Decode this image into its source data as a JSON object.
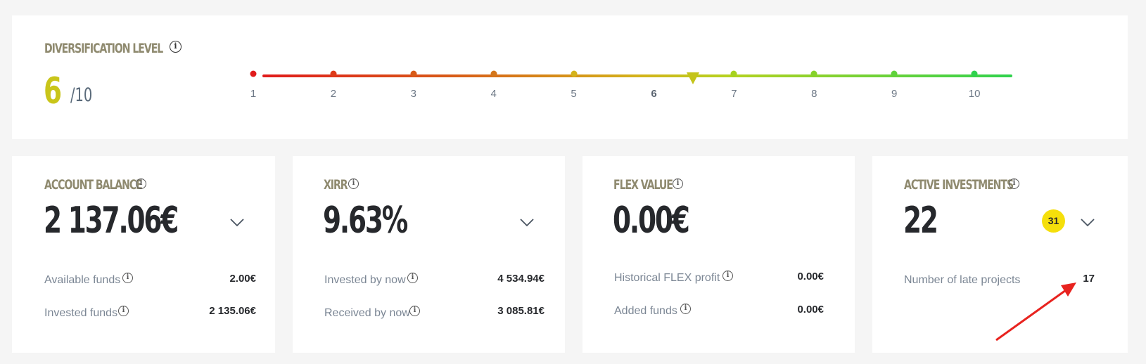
{
  "diversification": {
    "title": "DIVERSIFICATION LEVEL",
    "score": "6",
    "max": "/10",
    "level": 6,
    "ticks": [
      "1",
      "2",
      "3",
      "4",
      "5",
      "6",
      "7",
      "8",
      "9",
      "10"
    ],
    "colors": {
      "start": "#e01b1b",
      "mid": "#d4b21a",
      "end": "#2fd24d",
      "score": "#c9c51a"
    }
  },
  "account_balance": {
    "title": "ACCOUNT BALANCE",
    "value": "2 137.06€",
    "rows": [
      {
        "label": "Available funds",
        "value": "2.00€"
      },
      {
        "label": "Invested funds",
        "value": "2 135.06€"
      }
    ]
  },
  "xirr": {
    "title": "XIRR",
    "value": "9.63%",
    "rows": [
      {
        "label": "Invested by now",
        "value": "4 534.94€"
      },
      {
        "label": "Received by now",
        "value": "3 085.81€"
      }
    ]
  },
  "flex": {
    "title": "FLEX VALUE",
    "value": "0.00€",
    "rows": [
      {
        "label": "Historical FLEX profit",
        "value": "0.00€"
      },
      {
        "label": "Added funds",
        "value": "0.00€"
      }
    ]
  },
  "active": {
    "title": "ACTIVE INVESTMENTS",
    "value": "22",
    "badge": "31",
    "badge_color": "#f5df0b",
    "rows": [
      {
        "label": "Number of late projects",
        "value": "17"
      }
    ]
  },
  "icons": {
    "info": "info-icon",
    "expand": "chevron-down-icon",
    "annotation": "red-arrow-icon"
  }
}
